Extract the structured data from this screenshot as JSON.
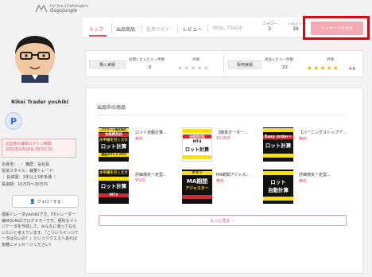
{
  "header": {
    "logo_line1": "for the Challengers",
    "logo_line2": "Gogojungle",
    "tabs": [
      {
        "label": "トップ"
      },
      {
        "label": "出品商品"
      },
      {
        "label": "投資ナビ+"
      },
      {
        "label": "レビュー"
      },
      {
        "label": "REAL TRADE"
      }
    ],
    "follow_label": "フォロー",
    "follow_count": "3",
    "follower_label": "フォロワー",
    "follower_count": "36",
    "message_button": "メッセージを送る"
  },
  "profile": {
    "name": "Rikei Trader yoshiki",
    "badge": "P",
    "login_line1": "出品者の最終ログイン時間:",
    "login_line2": "2022年1月18日 06:53:19",
    "info": [
      "出身地：‐ ｜ 職歴：会社員",
      "投資スタイル：裁量トレード",
      "｜ 投資歴：1年以上3年未満 ｜",
      "投資額：10万円〜30万円"
    ],
    "follow_button": "フォローする",
    "bio": "理系トレーダyoshikiです。FXトレーダー兼MQL4&5プログラマーです。便利なインジケータを作成して、みんなに使ってもらいたいと考えています。「こういうインジケータはないの？」というリクエストあれば気軽にメッセージください！"
  },
  "ratings": {
    "purchase_label": "購入実績",
    "purchase_reviews_label": "投稿したレビュー件数",
    "purchase_reviews_count": "0",
    "purchase_rating_label": "評価",
    "purchase_stars": 0,
    "sales_label": "販売実績",
    "sales_reviews_label": "商品レビュー件数",
    "sales_reviews_count": "22",
    "sales_rating_label": "評価",
    "sales_stars": 4.6,
    "sales_score": "4.6"
  },
  "products": {
    "section_title": "出品中の商品",
    "items": [
      {
        "title": "ロット自動計算...",
        "price": "無料"
      },
      {
        "title": "【簡単オーダー...",
        "price": "¥2,000"
      },
      {
        "title": "【バーニングストップア...",
        "price": "無料"
      },
      {
        "title": "評価損失一定型...",
        "price": "¥500"
      },
      {
        "title": "MA期間アジャス...",
        "price": "無料"
      },
      {
        "title": "評価損失一定型...",
        "price": "無料"
      }
    ],
    "thumbs": {
      "t1_top": "パスワード強化対応",
      "t1_red": "全銘柄対応",
      "t1_mid": "水平線を引くだけ",
      "t1_big": "ロット計算",
      "t1_sub": "損益/MT4 & MT5",
      "t2_mt": "MT4",
      "t2_big": "ロット計算",
      "t3_red": "Easy order+",
      "t3_big": "ロット計算",
      "t4_mid": "水平線を引くだけ",
      "t4_big": "ロット計算",
      "t4_mt": "MT4",
      "t5_top": "ボタン",
      "t5_big": "MA期間",
      "t5_sub": "アジャスター",
      "t6_big1": "ロット",
      "t6_big2": "自動計算"
    },
    "more_button": "もっと見る"
  }
}
